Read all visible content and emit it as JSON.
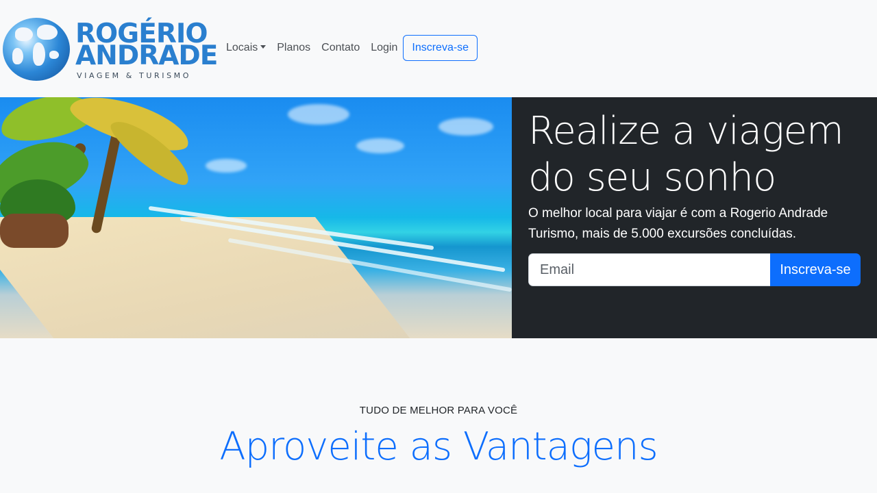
{
  "brand": {
    "line1": "ROGÉRIO",
    "line2": "ANDRADE",
    "tagline": "VIAGEM & TURISMO"
  },
  "nav": {
    "items": [
      {
        "label": "Locais",
        "dropdown": true
      },
      {
        "label": "Planos"
      },
      {
        "label": "Contato"
      },
      {
        "label": "Login"
      }
    ],
    "cta": "Inscreva-se"
  },
  "hero": {
    "image": "beach-with-palm-trees",
    "title": "Realize a viagem do seu sonho",
    "text": "O melhor local para viajar é com a Rogerio Andrade Turismo, mais de 5.000 excursões concluídas.",
    "email_placeholder": "Email",
    "submit": "Inscreva-se"
  },
  "features": {
    "eyebrow": "TUDO DE MELHOR PARA VOCÊ",
    "title": "Aproveite as Vantagens"
  },
  "colors": {
    "primary": "#0d6efd",
    "dark": "#212529",
    "logo_blue": "#2a7fcf"
  }
}
